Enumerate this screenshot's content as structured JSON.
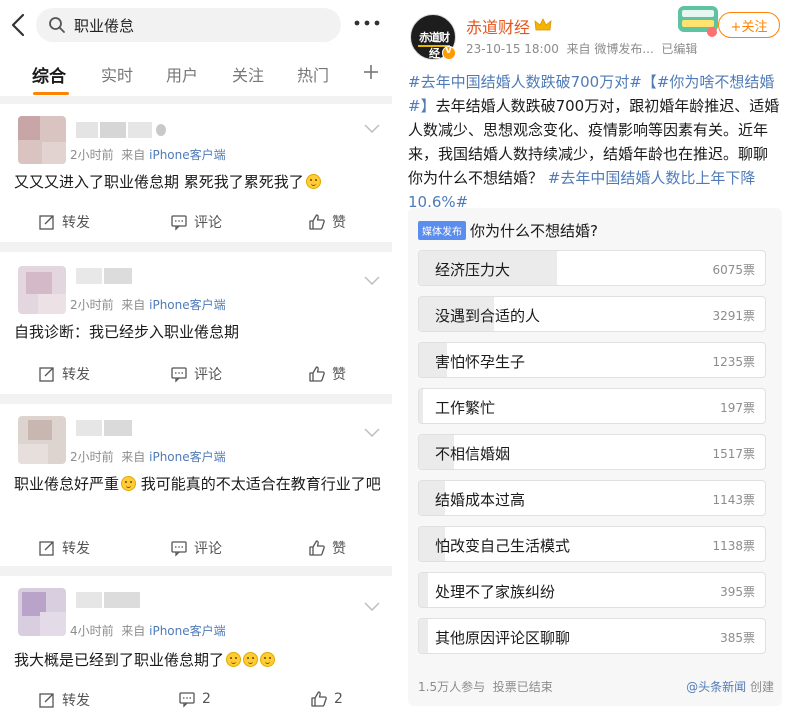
{
  "search": {
    "query": "职业倦怠"
  },
  "tabs": [
    {
      "label": "综合",
      "active": true
    },
    {
      "label": "实时",
      "active": false
    },
    {
      "label": "用户",
      "active": false
    },
    {
      "label": "关注",
      "active": false
    },
    {
      "label": "热门",
      "active": false
    }
  ],
  "posts": [
    {
      "time": "2小时前",
      "from": "来自",
      "source": "iPhone客户端",
      "text": "又又又进入了职业倦怠期 累死我了累死我了",
      "repost_label": "转发",
      "comment_label": "评论",
      "like_label": "赞"
    },
    {
      "time": "2小时前",
      "from": "来自",
      "source": "iPhone客户端",
      "text": "自我诊断：我已经步入职业倦怠期",
      "repost_label": "转发",
      "comment_label": "评论",
      "like_label": "赞"
    },
    {
      "time": "2小时前",
      "from": "来自",
      "source": "iPhone客户端",
      "text_a": "职业倦怠好严重",
      "text_b": " 我可能真的不太适合在教育行业了吧",
      "repost_label": "转发",
      "comment_label": "评论",
      "like_label": "赞"
    },
    {
      "time": "4小时前",
      "from": "来自",
      "source": "iPhone客户端",
      "text": "我大概是已经到了职业倦怠期了",
      "repost_label": "转发",
      "comment_label": "2",
      "like_label": "2"
    }
  ],
  "weibo": {
    "author": "赤道财经",
    "avatar_text": "赤道财经",
    "time": "23-10-15 18:00",
    "source": "来自 微博发布...",
    "edited": "已编辑",
    "follow_label": "+关注",
    "topic1": "#去年中国结婚人数跌破700万对#",
    "topic2": "【#你为啥不想结婚#】",
    "body": "去年结婚人数跌破700万对，跟初婚年龄推迟、适婚人数减少、思想观念变化、疫情影响等因素有关。近年来，我国结婚人数持续减少，结婚年龄也在推迟。聊聊你为什么不想结婚？",
    "topic3": "#去年中国结婚人数比上年下降10.6%#"
  },
  "poll": {
    "tag": "媒体发布",
    "question": "你为什么不想结婚?",
    "options": [
      {
        "label": "经济压力大",
        "count": "6075票",
        "votes": 6075
      },
      {
        "label": "没遇到合适的人",
        "count": "3291票",
        "votes": 3291
      },
      {
        "label": "害怕怀孕生子",
        "count": "1235票",
        "votes": 1235
      },
      {
        "label": "工作繁忙",
        "count": "197票",
        "votes": 197
      },
      {
        "label": "不相信婚姻",
        "count": "1517票",
        "votes": 1517
      },
      {
        "label": "结婚成本过高",
        "count": "1143票",
        "votes": 1143
      },
      {
        "label": "怕改变自己生活模式",
        "count": "1138票",
        "votes": 1138
      },
      {
        "label": "处理不了家族纠纷",
        "count": "395票",
        "votes": 395
      },
      {
        "label": "其他原因评论区聊聊",
        "count": "385票",
        "votes": 385
      }
    ],
    "participants": "1.5万人参与",
    "status": "投票已结束",
    "creator_link": "@头条新闻",
    "creator_suffix": " 创建"
  },
  "colors": {
    "accent": "#ff8200",
    "link": "#4f7bb8",
    "author": "#e8541b"
  }
}
